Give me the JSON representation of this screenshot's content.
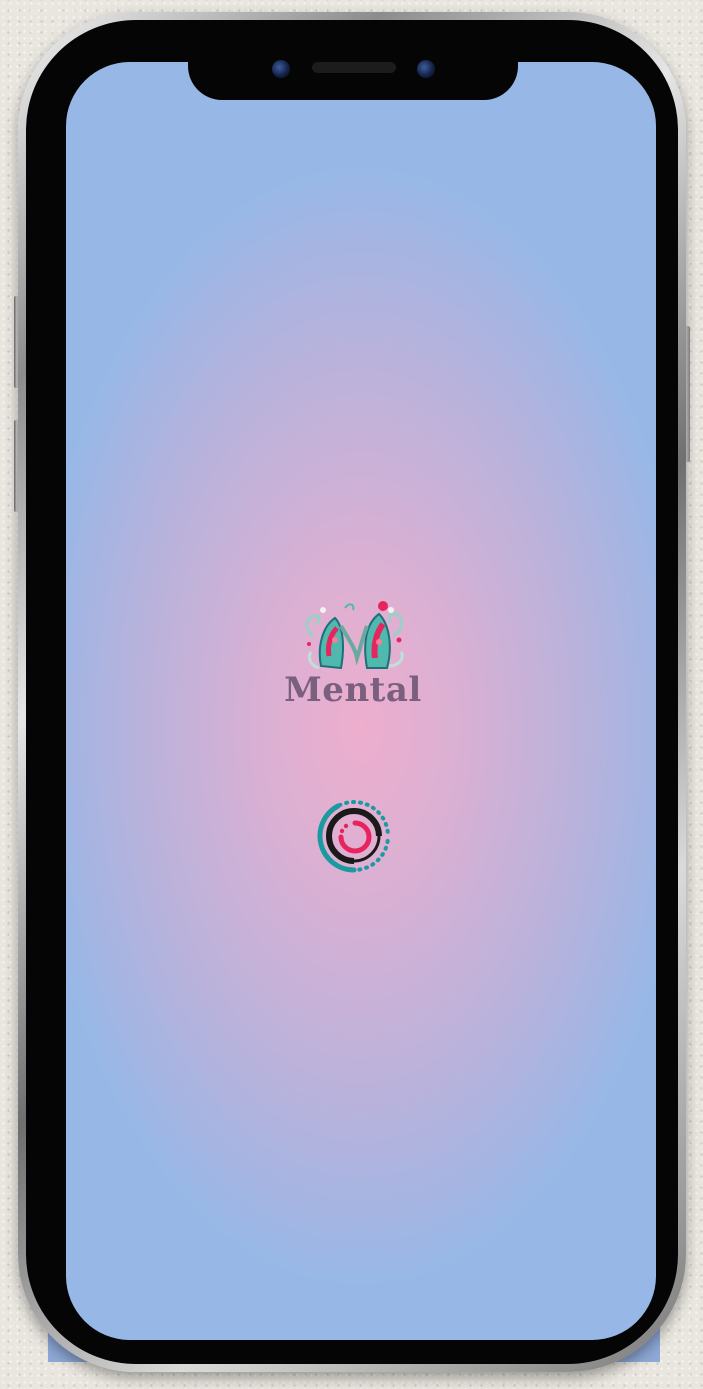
{
  "app": {
    "logo_text": "Mental"
  },
  "icons": {
    "logo": "mental-monogram-logo",
    "loader": "loading-spinner-icon"
  },
  "colors": {
    "gradient_center": "#eeaecd",
    "gradient_edge": "#97b8e7",
    "logo_text": "#7a5f7f",
    "spinner_teal": "#1b9aa0",
    "spinner_pink": "#e6245e",
    "spinner_dark": "#1a1a1a"
  }
}
